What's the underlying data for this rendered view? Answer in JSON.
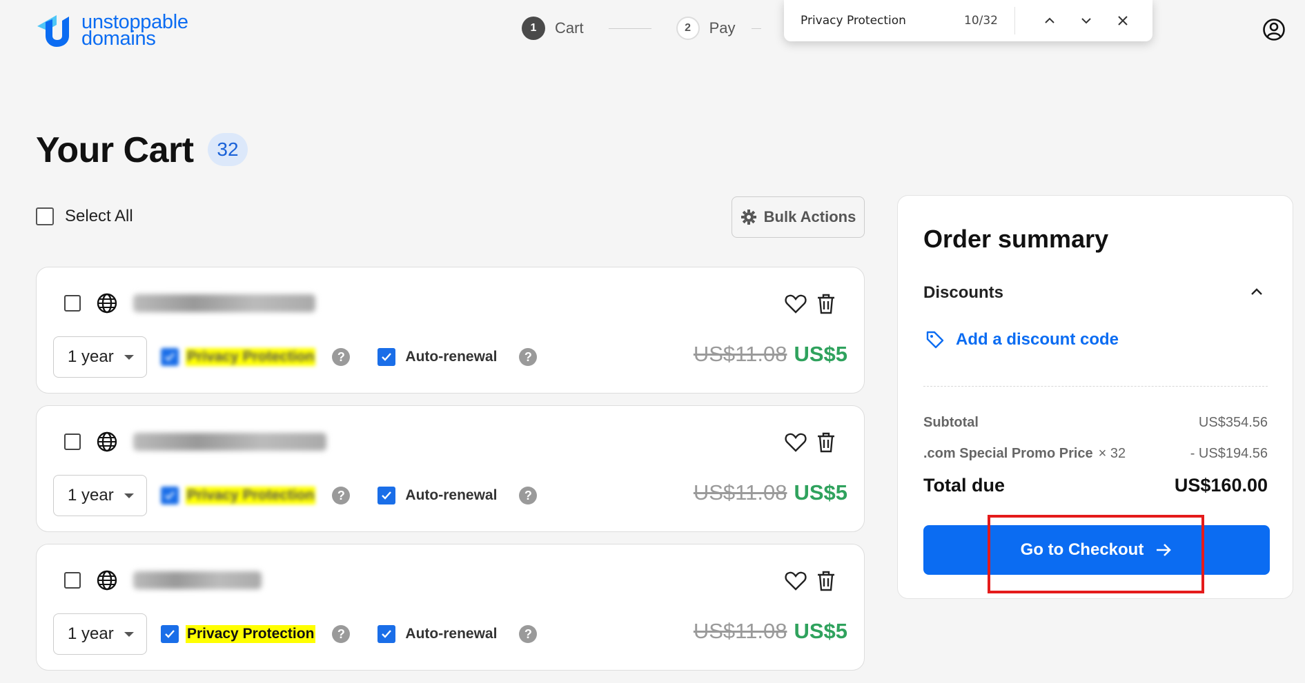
{
  "brand": {
    "line1": "unstoppable",
    "line2": "domains"
  },
  "stepper": [
    {
      "num": "1",
      "label": "Cart"
    },
    {
      "num": "2",
      "label": "Pay"
    }
  ],
  "findbar": {
    "query": "Privacy Protection",
    "count": "10/32"
  },
  "page": {
    "title": "Your Cart",
    "count": "32"
  },
  "select_all_label": "Select All",
  "bulk_actions_label": "Bulk Actions",
  "cart_items": [
    {
      "term": "1 year",
      "privacy_label": "Privacy Protection",
      "auto_renew_label": "Auto-renewal",
      "price_old": "US$11.08",
      "price_new": "US$5"
    },
    {
      "term": "1 year",
      "privacy_label": "Privacy Protection",
      "auto_renew_label": "Auto-renewal",
      "price_old": "US$11.08",
      "price_new": "US$5"
    },
    {
      "term": "1 year",
      "privacy_label": "Privacy Protection",
      "auto_renew_label": "Auto-renewal",
      "price_old": "US$11.08",
      "price_new": "US$5"
    }
  ],
  "summary": {
    "title": "Order summary",
    "discounts_label": "Discounts",
    "add_discount_label": "Add a discount code",
    "subtotal_label": "Subtotal",
    "subtotal_value": "US$354.56",
    "promo_label": ".com Special Promo Price",
    "promo_multiplier": "× 32",
    "promo_value": "- US$194.56",
    "total_label": "Total due",
    "total_value": "US$160.00",
    "checkout_label": "Go to Checkout"
  },
  "colors": {
    "accent": "#0b6cf2",
    "price_green": "#2fa25d",
    "highlight": "#ffff00",
    "annotation": "#e41b1b"
  }
}
